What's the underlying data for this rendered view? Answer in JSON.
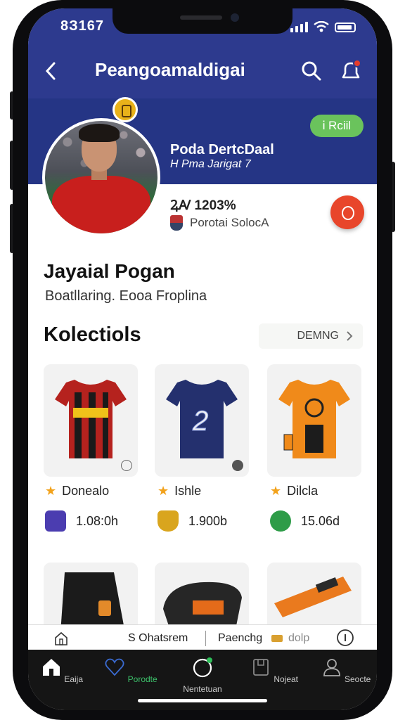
{
  "status": {
    "time": "8З167"
  },
  "header": {
    "title": "Peangoamaldigai"
  },
  "hero": {
    "add_label": "Ꭵ Rciil",
    "name": "Poda DertcDaal",
    "subtitle": "H Pma Jarigat 7"
  },
  "stats": {
    "value": "ꝜꜸ 1203%",
    "club": "Porotai SolocA"
  },
  "profile": {
    "name": "Jayaial Pogan",
    "description": "Boatllaring. Eooa Froplina"
  },
  "collections": {
    "title": "Kolectiols",
    "more_label": "DEMNG",
    "items": [
      {
        "name": "Donealo",
        "value": "1.08:0h",
        "shirt_color": "#b5221e",
        "badge_color": "#4b3db0"
      },
      {
        "name": "Ishle",
        "value": "1.900b",
        "shirt_color": "#24306e",
        "badge_color": "#d9a51e"
      },
      {
        "name": "Dilcla",
        "value": "15.06d",
        "shirt_color": "#f08a1a",
        "badge_color": "#2e9c48"
      }
    ]
  },
  "sub_bar": {
    "left": "S Ohatsrem",
    "middle": "Paenchg",
    "right": "dolp"
  },
  "bottom_nav": {
    "items": [
      {
        "label": "Eaija",
        "icon": "home-icon"
      },
      {
        "label": "Porodte",
        "icon": "heart-icon"
      },
      {
        "label": "Nentetuan",
        "icon": "ball-icon"
      },
      {
        "label": "Nojeat",
        "icon": "square-icon"
      },
      {
        "label": "Seocte",
        "icon": "profile-icon"
      }
    ]
  },
  "colors": {
    "header": "#2d3a8e",
    "accent_green": "#6ac35c",
    "fab": "#e8462b",
    "star": "#f2a21b"
  }
}
